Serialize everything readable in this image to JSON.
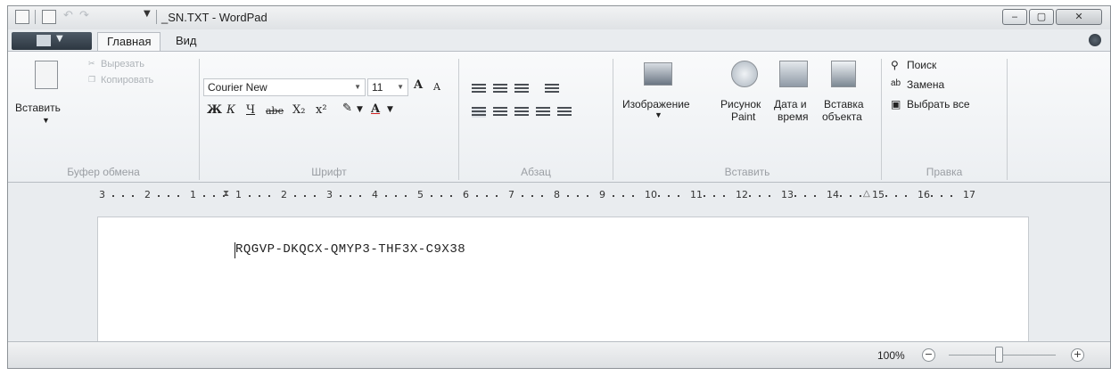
{
  "window": {
    "title": "_SN.TXT - WordPad",
    "minimize_label": "‒",
    "maximize_label": "▢",
    "close_label": "✕"
  },
  "tabs": {
    "home": "Главная",
    "view": "Вид"
  },
  "clipboard": {
    "paste_label": "Вставить",
    "cut_label": "Вырезать",
    "copy_label": "Копировать",
    "group_label": "Буфер обмена"
  },
  "font": {
    "family": "Courier New",
    "size": "11",
    "bold": "Ж",
    "italic": "К",
    "underline": "Ч",
    "strike": "abe",
    "subscript": "X₂",
    "superscript": "x²",
    "grow": "A",
    "shrink": "A",
    "text_color": "A",
    "group_label": "Шрифт"
  },
  "paragraph": {
    "group_label": "Абзац"
  },
  "insert": {
    "picture_label": "Изображение",
    "paint_label_1": "Рисунок",
    "paint_label_2": "Paint",
    "datetime_label_1": "Дата и",
    "datetime_label_2": "время",
    "object_label_1": "Вставка",
    "object_label_2": "объекта",
    "group_label": "Вставить"
  },
  "editing": {
    "find_label": "Поиск",
    "replace_label": "Замена",
    "select_all_label": "Выбрать все",
    "group_label": "Правка"
  },
  "ruler": {
    "ticks": [
      "3",
      "2",
      "1",
      "1",
      "2",
      "3",
      "4",
      "5",
      "6",
      "7",
      "8",
      "9",
      "10",
      "11",
      "12",
      "13",
      "14",
      "15",
      "16",
      "17"
    ]
  },
  "document": {
    "text": "RQGVP-DKQCX-QMYP3-THF3X-C9X38"
  },
  "status": {
    "zoom": "100%",
    "zoom_out": "−",
    "zoom_in": "+"
  },
  "colors": {
    "file_button": "#2d3741",
    "ribbon_bg": "#f4f6f8",
    "page_bg": "#ffffff"
  }
}
